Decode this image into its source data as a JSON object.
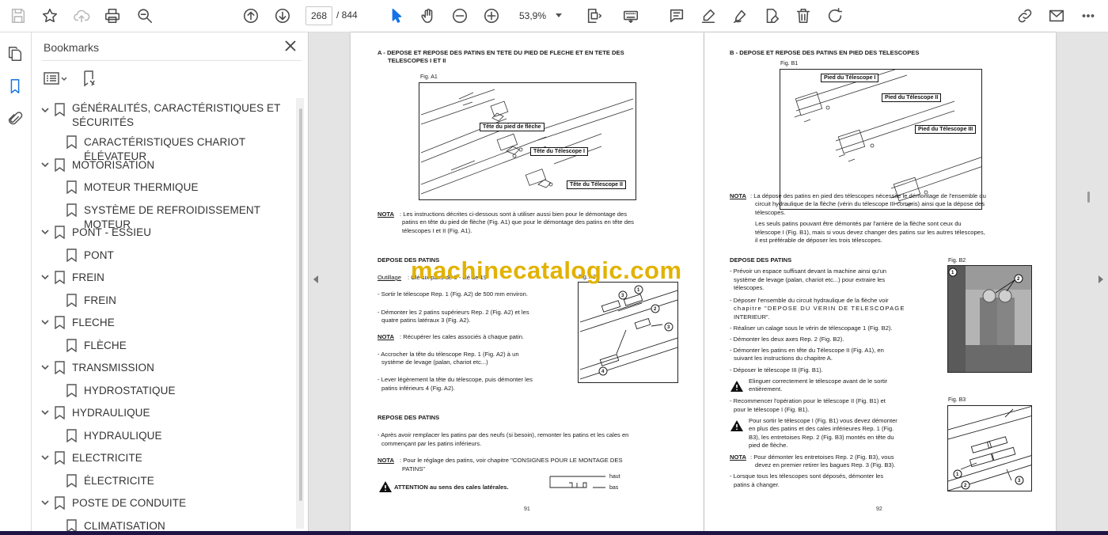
{
  "toolbar": {
    "page_current": "268",
    "page_total": "/  844",
    "zoom": "53,9%"
  },
  "bookmarks_panel": {
    "title": "Bookmarks",
    "items": [
      {
        "label": "GÉNÉRALITÉS, CARACTÉRISTIQUES ET",
        "label2": "SÉCURITÉS",
        "level": 0
      },
      {
        "label": "CARACTÉRISTIQUES CHARIOT ÉLÉVATEUR",
        "level": 1
      },
      {
        "label": "MOTORISATION",
        "level": 0
      },
      {
        "label": "MOTEUR THERMIQUE",
        "level": 1
      },
      {
        "label": "SYSTÈME DE REFROIDISSEMENT MOTEUR",
        "level": 1
      },
      {
        "label": "PONT - ESSIEU",
        "level": 0
      },
      {
        "label": "PONT",
        "level": 1
      },
      {
        "label": "FREIN",
        "level": 0
      },
      {
        "label": "FREIN",
        "level": 1
      },
      {
        "label": "FLECHE",
        "level": 0
      },
      {
        "label": "FLÈCHE",
        "level": 1
      },
      {
        "label": "TRANSMISSION",
        "level": 0
      },
      {
        "label": "HYDROSTATIQUE",
        "level": 1
      },
      {
        "label": "HYDRAULIQUE",
        "level": 0
      },
      {
        "label": "HYDRAULIQUE",
        "level": 1
      },
      {
        "label": "ELECTRICITE",
        "level": 0
      },
      {
        "label": "ÉLECTRICITE",
        "level": 1
      },
      {
        "label": "POSTE DE CONDUITE",
        "level": 0
      },
      {
        "label": "CLIMATISATION",
        "level": 1
      }
    ]
  },
  "watermark": "machinecatalogic.com",
  "page91": {
    "heading1": "A - DEPOSE ET REPOSE DES PATINS EN TETE DU PIED DE FLECHE ET EN TETE DES",
    "heading2": "TELESCOPES I ET II",
    "figA1": "Fig. A1",
    "figA1_labels": [
      "Tête du pied de flèche",
      "Tête du Télescope I",
      "Tête du Télescope II"
    ],
    "note_label": "NOTA",
    "note1_l1": ": Les instructions décrites ci-dessous sont à utiliser aussi bien pour le démontage des",
    "note1_l2": "patins en tête du pied de flèche (Fig. A1) que pour le démontage des patins en tête des",
    "note1_l3": "télescopes I et II (Fig. A1).",
    "depose_title": "DEPOSE DES PATINS",
    "outillage_label": "Outillage",
    "outillage_text": ": Clé six pans de 6 - clé de 19",
    "figA2": "Fig. A2",
    "step1": "- Sortir le télescope Rep. 1 (Fig. A2) de 500 mm environ.",
    "step2_l1": "- Démonter les 2 patins supérieurs Rep. 2 (Fig. A2) et les",
    "step2_l2": "quatre patins latéraux 3 (Fig. A2).",
    "note2": ": Récupérer les cales associés à chaque patin.",
    "step3_l1": "- Accrocher la tête du télescope Rep. 1 (Fig. A2) à un",
    "step3_l2": "système de levage (palan, chariot etc...)",
    "step4_l1": "- Lever légèrement la tête du télescope, puis démonter les",
    "step4_l2": "patins inférieurs 4 (Fig. A2).",
    "repose_title": "REPOSE DES PATINS",
    "repose_l1": "- Après avoir remplacer les patins par des neufs (si besoin), remonter les patins et les cales en",
    "repose_l2": "commençant par les patins inférieurs.",
    "note3_l1": ": Pour le réglage des patins, voir chapitre \"CONSIGNES POUR LE MONTAGE DES",
    "note3_l2": "PATINS\"",
    "attention": "ATTENTION au sens des cales latérales.",
    "haut": "haut",
    "bas": "bas",
    "page_number": "91"
  },
  "page92": {
    "heading": "B - DEPOSE ET REPOSE DES PATINS EN PIED DES TELESCOPES",
    "figB1": "Fig. B1",
    "figB1_labels": [
      "Pied du Télescope I",
      "Pied du Télescope II",
      "Pied du Télescope III"
    ],
    "note_label": "NOTA",
    "note1_l1": ": La dépose des patins en pied des télescopes nécessite le démontage de l'ensemble du",
    "note1_l2": "circuit hydraulique de la flèche (vérin du télescope III compris) ainsi que la dépose des",
    "note1_l3": "télescopes.",
    "note1_l4": "Les seuls patins pouvant être démontés par l'arrière de la flèche sont ceux du",
    "note1_l5": "télescope I (Fig. B1), mais si vous devez changer des patins sur les autres télescopes,",
    "note1_l6": "il est préférable de déposer les trois télescopes.",
    "depose_title": "DEPOSE DES PATINS",
    "figB2": "Fig. B2",
    "s1_l1": "- Prévoir un espace suffisant devant la machine ainsi qu'un",
    "s1_l2": "système de levage (palan, chariot etc...) pour extraire les",
    "s1_l3": "télescopes.",
    "s2_l1": "- Déposer l'ensemble du circuit hydraulique de la flèche voir",
    "s2_l2": "chapitre \"DEPOSE DU VERIN DE TELESCOPAGE",
    "s2_l3": "INTERIEUR\".",
    "s3": "- Réaliser un calage sous le vérin de télescopage 1 (Fig. B2).",
    "s4": "- Démonter les deux axes Rep. 2 (Fig. B2).",
    "s5_l1": "- Démonter les patins en tête du Télescope II (Fig. A1), en",
    "s5_l2": "suivant les instructions du chapitre A.",
    "s6": "- Déposer le télescope III (Fig. B1).",
    "w1_l1": "Elinguer correctement le télescope avant de le sortir",
    "w1_l2": "entièrement.",
    "s7_l1": "- Recommencer l'opération pour le télescope II (Fig. B1) et",
    "s7_l2": "pour le télescope I (Fig. B1).",
    "figB3": "Fig. B3",
    "w2_l1": "Pour sortir le télescope I (Fig. B1) vous devez démonter",
    "w2_l2": "en plus des patins et des cales inférieures Rep. 1 (Fig.",
    "w2_l3": "B3), les entretoises Rep. 2 (Fig. B3) montés en tête du",
    "w2_l4": "pied de flèche.",
    "note2_l1": ": Pour démonter les entretoises Rep. 2 (Fig. B3), vous",
    "note2_l2": "devez en premier retirer les bagues Rep. 3 (Fig. B3).",
    "s8_l1": "- Lorsque tous les télescopes sont déposés, démonter les",
    "s8_l2": "patins à changer.",
    "page_number": "92"
  }
}
